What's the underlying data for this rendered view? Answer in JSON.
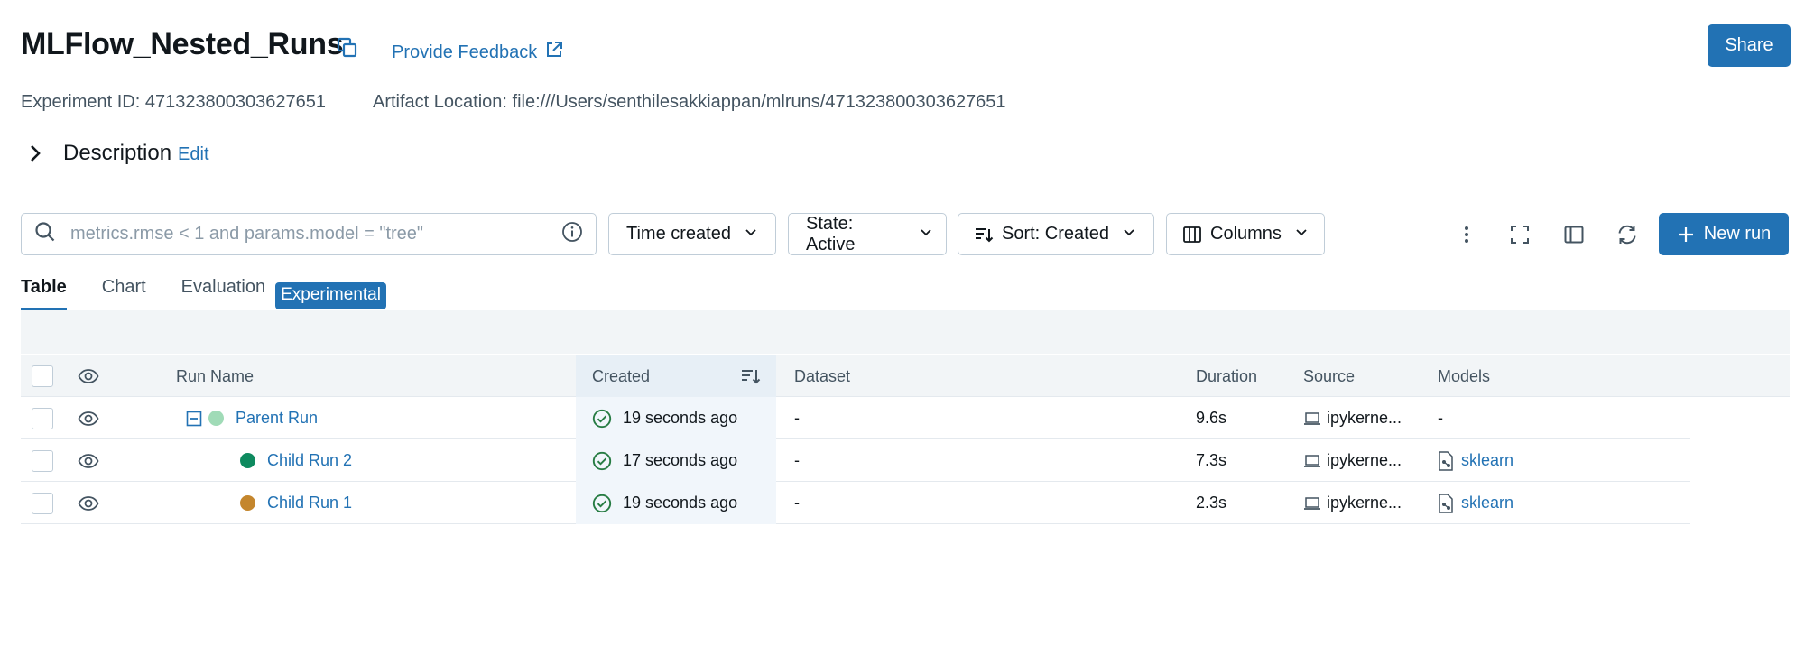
{
  "header": {
    "title": "MLFlow_Nested_Runs",
    "feedback_label": "Provide Feedback",
    "share_label": "Share",
    "experiment_id_text": "Experiment ID: 471323800303627651",
    "artifact_location_text": "Artifact Location: file:///Users/senthilesakkiappan/mlruns/471323800303627651"
  },
  "description": {
    "label": "Description",
    "edit_label": "Edit"
  },
  "toolbar": {
    "search_placeholder": "metrics.rmse < 1 and params.model = \"tree\"",
    "time_created_label": "Time created",
    "state_label": "State: Active",
    "sort_label": "Sort: Created",
    "columns_label": "Columns",
    "new_run_label": "New run"
  },
  "tabs": [
    {
      "label": "Table",
      "active": true
    },
    {
      "label": "Chart",
      "active": false
    },
    {
      "label": "Evaluation",
      "active": false,
      "badge": "Experimental"
    }
  ],
  "table": {
    "headers": {
      "run_name": "Run Name",
      "created": "Created",
      "dataset": "Dataset",
      "duration": "Duration",
      "source": "Source",
      "models": "Models"
    },
    "rows": [
      {
        "name": "Parent Run",
        "dot_color": "#a0dbb7",
        "expander": true,
        "created": "19 seconds ago",
        "dataset": "-",
        "duration": "9.6s",
        "source": "ipykerne...",
        "models": "-"
      },
      {
        "name": "Child Run 2",
        "dot_color": "#0e8a5f",
        "expander": false,
        "created": "17 seconds ago",
        "dataset": "-",
        "duration": "7.3s",
        "source": "ipykerne...",
        "models": "sklearn"
      },
      {
        "name": "Child Run 1",
        "dot_color": "#c4862d",
        "expander": false,
        "created": "19 seconds ago",
        "dataset": "-",
        "duration": "2.3s",
        "source": "ipykerne...",
        "models": "sklearn"
      }
    ]
  },
  "colors": {
    "primary": "#2272b4",
    "success": "#277c43"
  }
}
